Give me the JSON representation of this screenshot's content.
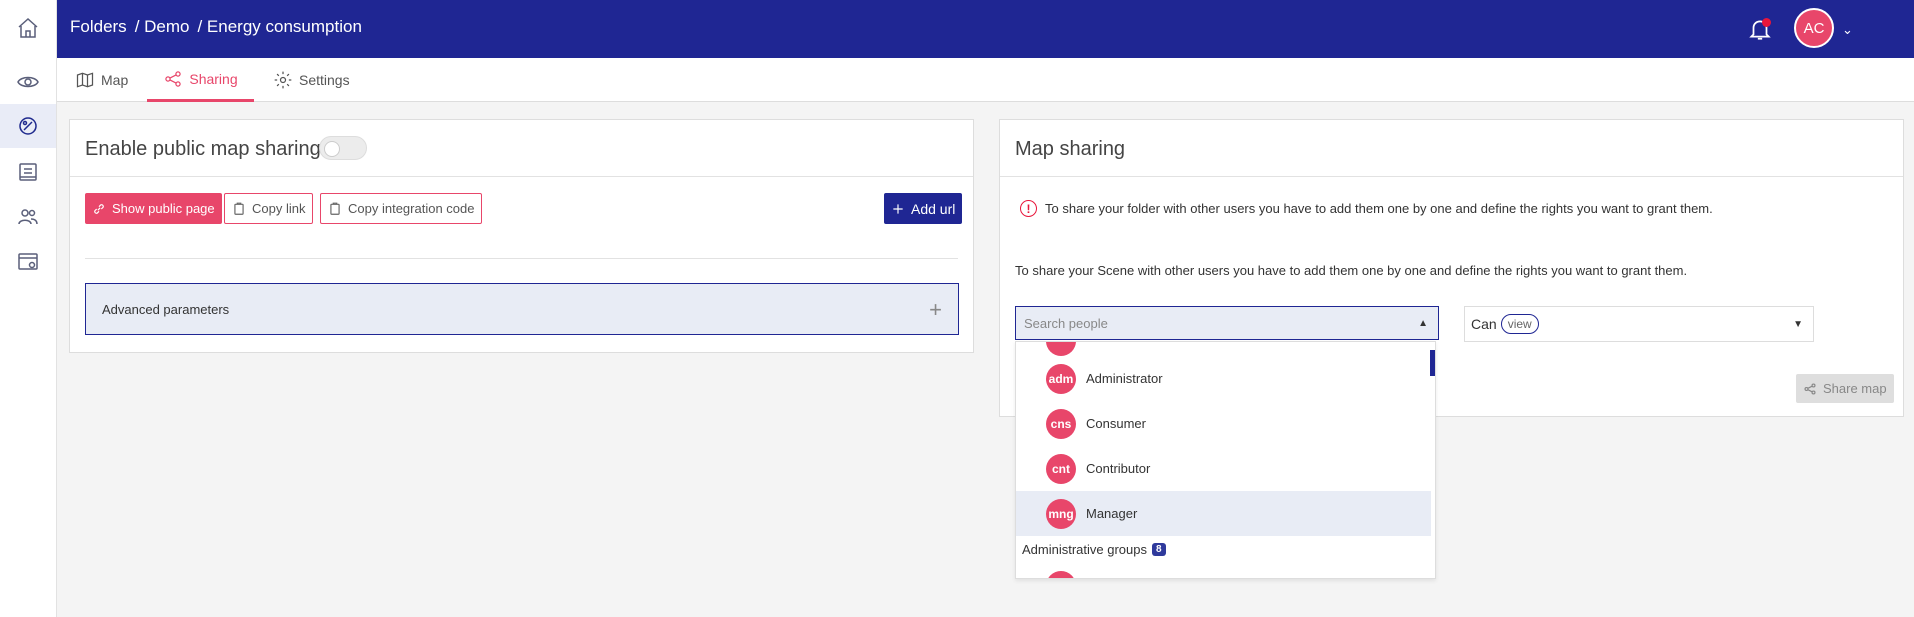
{
  "breadcrumb": [
    "Folders",
    "/ Demo",
    "/ Energy consumption"
  ],
  "user": {
    "initials": "AC"
  },
  "tabs": [
    {
      "label": "Map",
      "icon": "map-icon"
    },
    {
      "label": "Sharing",
      "icon": "share-icon"
    },
    {
      "label": "Settings",
      "icon": "gear-icon"
    }
  ],
  "public_sharing": {
    "title": "Enable public map sharing",
    "show_public_page": "Show public page",
    "copy_link": "Copy link",
    "copy_integration_code": "Copy integration code",
    "add_url": "Add url",
    "advanced_parameters": "Advanced parameters"
  },
  "map_sharing": {
    "title": "Map sharing",
    "info_folder": "To share your folder with other users you have to add them one by one and define the rights you want to grant them.",
    "info_scene": "To share your Scene with other users you have to add them one by one and define the rights you want to grant them.",
    "search_placeholder": "Search people",
    "perm_prefix": "Can",
    "perm_value": "view",
    "share_button": "Share map"
  },
  "dropdown": {
    "options": [
      {
        "abbr": "adm",
        "label": "Administrator"
      },
      {
        "abbr": "cns",
        "label": "Consumer"
      },
      {
        "abbr": "cnt",
        "label": "Contributor"
      },
      {
        "abbr": "mng",
        "label": "Manager"
      }
    ],
    "group_label": "Administrative groups",
    "group_count": "8"
  },
  "colors": {
    "navy": "#1f2693",
    "pink": "#e8466a",
    "alert": "#e8163b"
  }
}
